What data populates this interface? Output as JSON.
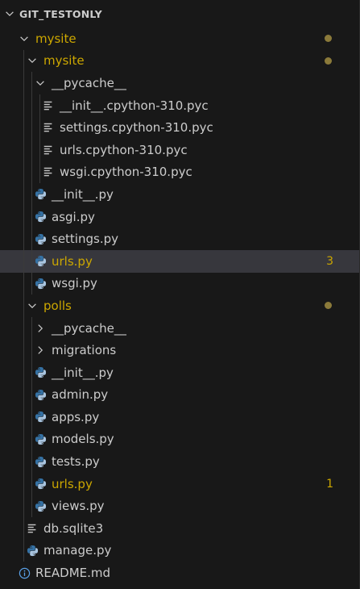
{
  "explorer": {
    "section_title": "GIT_TESTONLY",
    "colors": {
      "background": "#181818",
      "selected_row": "#37373d",
      "modified_text": "#cca700",
      "modified_dot": "#8b7a3a",
      "python_blue": "#3572a5",
      "python_light": "#a9c5e0"
    },
    "tree": [
      {
        "label": "mysite",
        "type": "folder",
        "expanded": true,
        "modified": true,
        "dot": true,
        "depth": 0
      },
      {
        "label": "mysite",
        "type": "folder",
        "expanded": true,
        "modified": true,
        "dot": true,
        "depth": 1
      },
      {
        "label": "__pycache__",
        "type": "folder",
        "expanded": true,
        "modified": false,
        "depth": 2
      },
      {
        "label": "__init__.cpython-310.pyc",
        "type": "file",
        "icon": "lines-file-icon",
        "depth": 3
      },
      {
        "label": "settings.cpython-310.pyc",
        "type": "file",
        "icon": "lines-file-icon",
        "depth": 3
      },
      {
        "label": "urls.cpython-310.pyc",
        "type": "file",
        "icon": "lines-file-icon",
        "depth": 3
      },
      {
        "label": "wsgi.cpython-310.pyc",
        "type": "file",
        "icon": "lines-file-icon",
        "depth": 3
      },
      {
        "label": "__init__.py",
        "type": "file",
        "icon": "python-icon",
        "depth": 2
      },
      {
        "label": "asgi.py",
        "type": "file",
        "icon": "python-icon",
        "depth": 2
      },
      {
        "label": "settings.py",
        "type": "file",
        "icon": "python-icon",
        "depth": 2
      },
      {
        "label": "urls.py",
        "type": "file",
        "icon": "python-icon",
        "depth": 2,
        "modified": true,
        "selected": true,
        "badge": "3"
      },
      {
        "label": "wsgi.py",
        "type": "file",
        "icon": "python-icon",
        "depth": 2
      },
      {
        "label": "polls",
        "type": "folder",
        "expanded": true,
        "modified": true,
        "dot": true,
        "depth": 1
      },
      {
        "label": "__pycache__",
        "type": "folder",
        "expanded": false,
        "depth": 2
      },
      {
        "label": "migrations",
        "type": "folder",
        "expanded": false,
        "depth": 2
      },
      {
        "label": "__init__.py",
        "type": "file",
        "icon": "python-icon",
        "depth": 2
      },
      {
        "label": "admin.py",
        "type": "file",
        "icon": "python-icon",
        "depth": 2
      },
      {
        "label": "apps.py",
        "type": "file",
        "icon": "python-icon",
        "depth": 2
      },
      {
        "label": "models.py",
        "type": "file",
        "icon": "python-icon",
        "depth": 2
      },
      {
        "label": "tests.py",
        "type": "file",
        "icon": "python-icon",
        "depth": 2
      },
      {
        "label": "urls.py",
        "type": "file",
        "icon": "python-icon",
        "depth": 2,
        "modified": true,
        "badge": "1"
      },
      {
        "label": "views.py",
        "type": "file",
        "icon": "python-icon",
        "depth": 2
      },
      {
        "label": "db.sqlite3",
        "type": "file",
        "icon": "lines-file-icon",
        "depth": 1
      },
      {
        "label": "manage.py",
        "type": "file",
        "icon": "python-icon",
        "depth": 1
      },
      {
        "label": "README.md",
        "type": "file",
        "icon": "info-icon",
        "depth": 0
      }
    ]
  }
}
